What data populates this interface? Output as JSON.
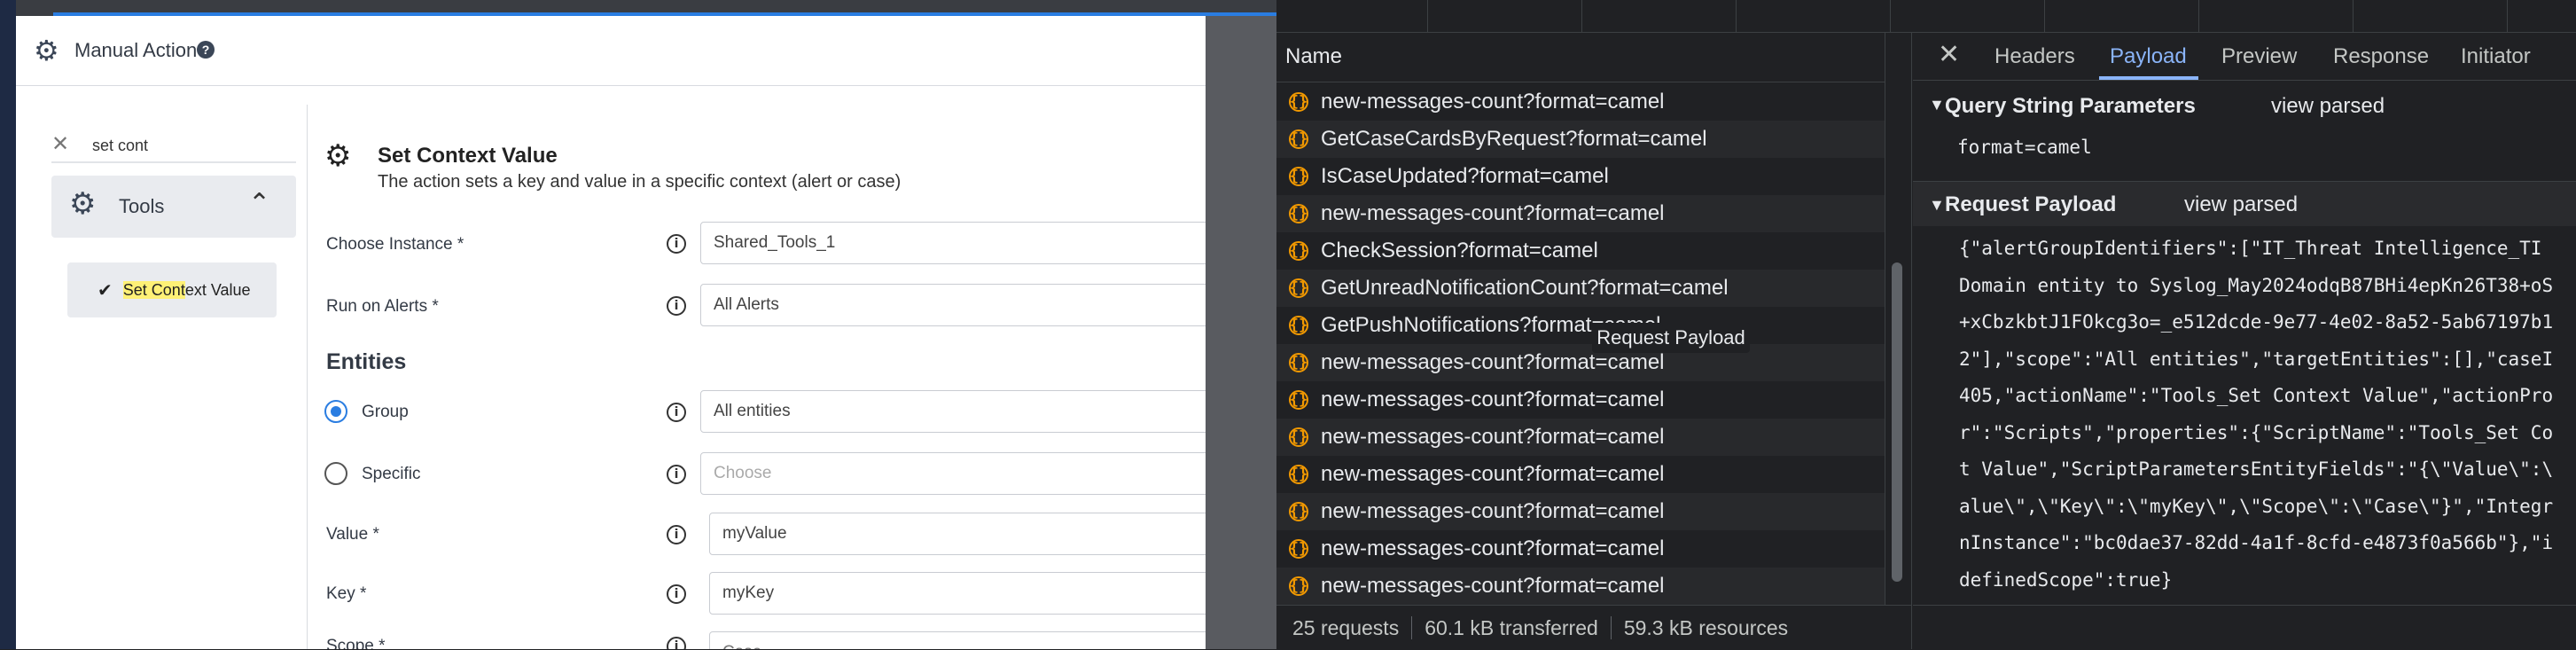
{
  "modal": {
    "title": "Manual Action",
    "help_glyph": "?",
    "search_value": "set cont",
    "tools_label": "Tools",
    "result_prefix": "Set ",
    "result_highlight": "Cont",
    "result_suffix": "ext Value",
    "action_title": "Set Context Value",
    "action_desc": "The action sets a key and value in a specific context (alert or case)",
    "fields": {
      "instance_label": "Choose Instance *",
      "instance_value": "Shared_Tools_1",
      "run_on_alerts_label": "Run on Alerts *",
      "run_on_alerts_value": "All Alerts",
      "entities_heading": "Entities",
      "group_label": "Group",
      "group_value": "All entities",
      "specific_label": "Specific",
      "specific_placeholder": "Choose",
      "value_label": "Value  *",
      "value_value": "myValue",
      "key_label": "Key  *",
      "key_value": "myKey",
      "scope_label": "Scope  *",
      "scope_value": "Case"
    }
  },
  "devtools": {
    "name_header": "Name",
    "requests": [
      "new-messages-count?format=camel",
      "GetCaseCardsByRequest?format=camel",
      "IsCaseUpdated?format=camel",
      "new-messages-count?format=camel",
      "CheckSession?format=camel",
      "GetUnreadNotificationCount?format=camel",
      "GetPushNotifications?format=camel",
      "new-messages-count?format=camel",
      "new-messages-count?format=camel",
      "new-messages-count?format=camel",
      "new-messages-count?format=camel",
      "new-messages-count?format=camel",
      "new-messages-count?format=camel",
      "new-messages-count?format=camel"
    ],
    "tooltip": "Request Payload",
    "status": {
      "requests": "25 requests",
      "transferred": "60.1 kB transferred",
      "resources": "59.3 kB resources"
    },
    "tabs": [
      "Headers",
      "Payload",
      "Preview",
      "Response",
      "Initiator"
    ],
    "active_tab": "Payload",
    "query_section": "Query String Parameters",
    "view_parsed": "view parsed",
    "query_value": "format=camel",
    "payload_section": "Request Payload",
    "payload_lines": [
      "{\"alertGroupIdentifiers\":[\"IT_Threat Intelligence_TI",
      "Domain entity to Syslog_May2024odqB87BHi4epKn26T38+oS",
      "+xCbzkbtJ1FOkcg3o=_e512dcde-9e77-4e02-8a52-5ab67197b1",
      "2\"],\"scope\":\"All entities\",\"targetEntities\":[],\"caseI",
      "405,\"actionName\":\"Tools_Set Context Value\",\"actionPro",
      "r\":\"Scripts\",\"properties\":{\"ScriptName\":\"Tools_Set Co",
      "t Value\",\"ScriptParametersEntityFields\":\"{\\\"Value\\\":\\",
      "alue\\\",\\\"Key\\\":\\\"myKey\\\",\\\"Scope\\\":\\\"Case\\\"}\",\"Integr",
      "nInstance\":\"bc0dae37-82dd-4a1f-8cfd-e4873f0a566b\"},\"i",
      "definedScope\":true}"
    ]
  }
}
